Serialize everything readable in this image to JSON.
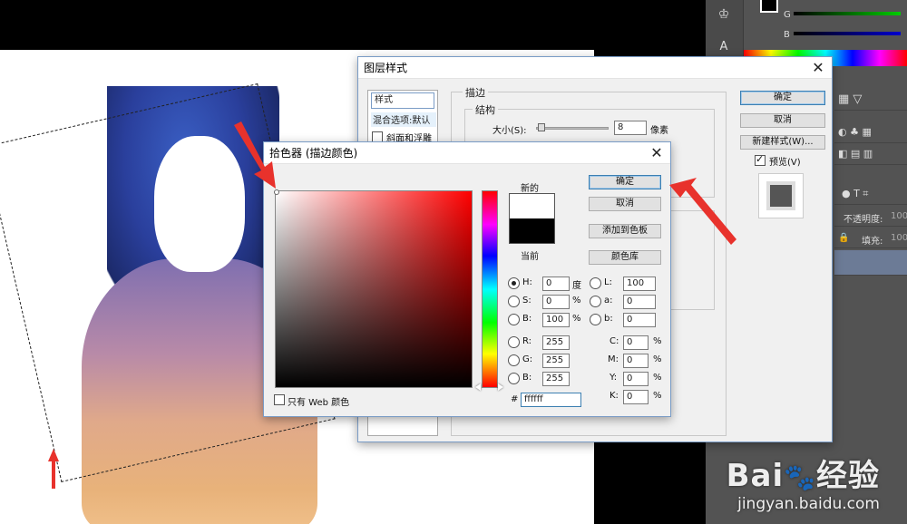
{
  "canvas": {
    "marquee": "dashed-selection"
  },
  "right_panels": {
    "color_labels": [
      "G",
      "B"
    ],
    "opacity_label": "不透明度:",
    "opacity_value": "100",
    "fill_label": "填充:",
    "fill_value": "100"
  },
  "layer_style": {
    "title": "图层样式",
    "sidebar": {
      "styles_header": "样式",
      "blend_options": "混合选项:默认",
      "bevel": "斜面和浮雕"
    },
    "stroke_group": "描边",
    "structure_group": "结构",
    "size_label": "大小(S):",
    "size_value": "8",
    "size_unit": "像素",
    "buttons": {
      "ok": "确定",
      "cancel": "取消",
      "new_style": "新建样式(W)...",
      "preview": "预览(V)"
    },
    "preview_checked": true
  },
  "color_picker": {
    "title": "拾色器 (描边颜色)",
    "new_label": "新的",
    "current_label": "当前",
    "buttons": {
      "ok": "确定",
      "cancel": "取消",
      "add_swatch": "添加到色板",
      "libraries": "颜色库"
    },
    "hsb": [
      {
        "label": "H:",
        "value": "0",
        "unit": "度",
        "selected": true
      },
      {
        "label": "S:",
        "value": "0",
        "unit": "%"
      },
      {
        "label": "B:",
        "value": "100",
        "unit": "%"
      }
    ],
    "rgb": [
      {
        "label": "R:",
        "value": "255"
      },
      {
        "label": "G:",
        "value": "255"
      },
      {
        "label": "B:",
        "value": "255"
      }
    ],
    "lab": [
      {
        "label": "L:",
        "value": "100"
      },
      {
        "label": "a:",
        "value": "0"
      },
      {
        "label": "b:",
        "value": "0"
      }
    ],
    "cmyk": [
      {
        "label": "C:",
        "value": "0",
        "unit": "%"
      },
      {
        "label": "M:",
        "value": "0",
        "unit": "%"
      },
      {
        "label": "Y:",
        "value": "0",
        "unit": "%"
      },
      {
        "label": "K:",
        "value": "0",
        "unit": "%"
      }
    ],
    "hex_label": "#",
    "hex_value": "ffffff",
    "web_only_label": "只有 Web 颜色",
    "new_color": "#ffffff",
    "current_color": "#000000"
  },
  "watermark": {
    "brand": "Bai",
    "brand2": "经验",
    "url": "jingyan.baidu.com"
  },
  "colors": {
    "annotation_red": "#e8322c",
    "dialog_bg": "#f0f0f0",
    "accent_border": "#3c7fb1"
  }
}
